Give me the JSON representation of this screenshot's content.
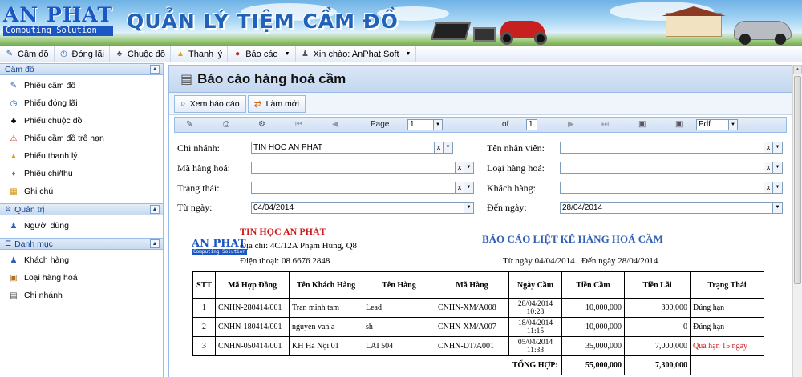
{
  "banner": {
    "logo_main": "AN PHAT",
    "logo_sub": "Computing Solution",
    "app_title": "QUẢN LÝ TIỆM CẦM ĐỒ"
  },
  "menu": {
    "items": [
      {
        "label": "Cầm đồ",
        "icon": "pawn-icon"
      },
      {
        "label": "Đóng lãi",
        "icon": "clock-icon"
      },
      {
        "label": "Chuộc đồ",
        "icon": "redeem-icon"
      },
      {
        "label": "Thanh lý",
        "icon": "liquidate-icon"
      },
      {
        "label": "Báo cáo",
        "icon": "report-icon",
        "dropdown": true
      },
      {
        "label": "Xin chào: AnPhat Soft",
        "icon": "user-icon",
        "dropdown": true
      }
    ]
  },
  "sidebar": {
    "groups": [
      {
        "title": "Cầm đồ",
        "items": [
          "Phiếu cầm đồ",
          "Phiếu đóng lãi",
          "Phiếu chuộc đồ",
          "Phiếu cầm đồ trễ hạn",
          "Phiếu thanh lý",
          "Phiếu chi/thu",
          "Ghi chú"
        ]
      },
      {
        "title": "Quản trị",
        "items": [
          "Người dùng"
        ]
      },
      {
        "title": "Danh mục",
        "items": [
          "Khách hàng",
          "Loại hàng hoá",
          "Chi nhánh"
        ]
      }
    ]
  },
  "panel": {
    "title": "Báo cáo hàng hoá cầm",
    "buttons": {
      "view_report": "Xem báo cáo",
      "refresh": "Làm mới"
    },
    "pager": {
      "page_label": "Page",
      "page_value": "1",
      "of_label": "of",
      "total_pages": "1",
      "export_format": "Pdf"
    }
  },
  "filters": {
    "branch": {
      "label": "Chi nhánh:",
      "value": "TIN HOC AN PHAT"
    },
    "item_code": {
      "label": "Mã hàng hoá:",
      "value": ""
    },
    "status": {
      "label": "Trạng thái:",
      "value": ""
    },
    "from_date": {
      "label": "Từ ngày:",
      "value": "04/04/2014"
    },
    "employee": {
      "label": "Tên nhân viên:",
      "value": ""
    },
    "item_type": {
      "label": "Loại hàng hoá:",
      "value": ""
    },
    "customer": {
      "label": "Khách hàng:",
      "value": ""
    },
    "to_date": {
      "label": "Đến ngày:",
      "value": "28/04/2014"
    }
  },
  "report": {
    "logo_main": "AN PHAT",
    "logo_sub": "Computing Solution",
    "company": "TIN HỌC AN PHÁT",
    "address": "Địa chỉ: 4C/12A Phạm Hùng, Q8",
    "phone": "Điện thoại: 08 6676 2848",
    "title": "BÁO CÁO LIỆT KÊ HÀNG HOÁ CẦM",
    "date_from": "Từ ngày 04/04/2014",
    "date_to": "Đến ngày 28/04/2014",
    "columns": [
      "STT",
      "Mã Hợp Đồng",
      "Tên Khách Hàng",
      "Tên Hàng",
      "Mã Hàng",
      "Ngày Cầm",
      "Tiền Cầm",
      "Tiền Lãi",
      "Trạng Thái"
    ],
    "rows": [
      {
        "stt": "1",
        "contract": "CNHN-280414/001",
        "customer": "Tran minh tam",
        "item": "Lead",
        "code": "CNHN-XM/A008",
        "date": "28/04/2014",
        "time": "10:28",
        "amount": "10,000,000",
        "interest": "300,000",
        "status": "Đúng hạn",
        "overdue": false
      },
      {
        "stt": "2",
        "contract": "CNHN-180414/001",
        "customer": "nguyen van a",
        "item": "sh",
        "code": "CNHN-XM/A007",
        "date": "18/04/2014",
        "time": "11:15",
        "amount": "10,000,000",
        "interest": "0",
        "status": "Đúng hạn",
        "overdue": false
      },
      {
        "stt": "3",
        "contract": "CNHN-050414/001",
        "customer": "KH Hà Nội 01",
        "item": "LAI 504",
        "code": "CNHN-DT/A001",
        "date": "05/04/2014",
        "time": "11:33",
        "amount": "35,000,000",
        "interest": "7,000,000",
        "status": "Quá hạn 15 ngày",
        "overdue": true
      }
    ],
    "total_label": "TỔNG HỢP:",
    "total_amount": "55,000,000",
    "total_interest": "7,300,000"
  }
}
